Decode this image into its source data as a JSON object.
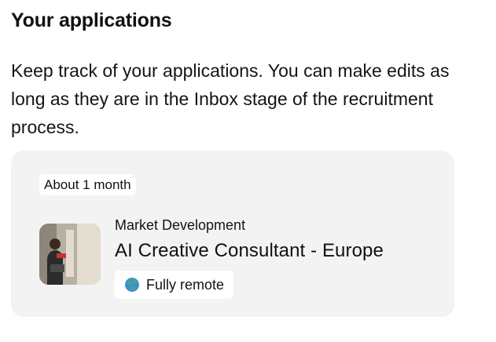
{
  "header": {
    "title": "Your applications"
  },
  "intro": {
    "text": "Keep track of your applications. You can make edits as long as they are in the Inbox stage of the recruitment process."
  },
  "applications": [
    {
      "age": "About 1 month",
      "department": "Market Development",
      "title": "AI Creative Consultant - Europe",
      "location": "Fully remote",
      "location_icon": "globe-icon",
      "thumbnail_icon": "job-thumbnail"
    }
  ],
  "colors": {
    "card_background": "#f3f3f3",
    "badge_background": "#ffffff",
    "text": "#111111"
  }
}
